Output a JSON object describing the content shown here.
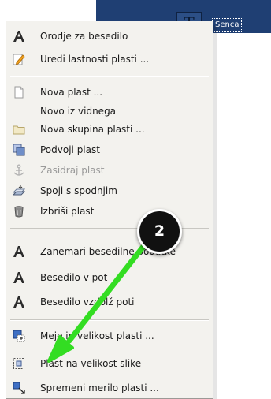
{
  "background": {
    "layer_name": "Senca",
    "thumb_glyph": "T",
    "strip_color": "#1f3f73"
  },
  "menu": {
    "items": [
      {
        "id": "text-tool",
        "label": "Orodje za besedilo",
        "icon": "text-tool-icon",
        "enabled": true
      },
      {
        "id": "edit-attributes",
        "label": "Uredi lastnosti plasti ...",
        "icon": "edit-attributes-icon",
        "enabled": true
      },
      {
        "id": "new-layer",
        "label": "Nova plast ...",
        "icon": "new-layer-icon",
        "enabled": true
      },
      {
        "id": "new-from-visible",
        "label": "Novo iz vidnega",
        "icon": "",
        "enabled": true
      },
      {
        "id": "new-layer-group",
        "label": "Nova skupina plasti ...",
        "icon": "folder-icon",
        "enabled": true
      },
      {
        "id": "duplicate-layer",
        "label": "Podvoji plast",
        "icon": "duplicate-icon",
        "enabled": true
      },
      {
        "id": "anchor-layer",
        "label": "Zasidraj plast",
        "icon": "anchor-icon",
        "enabled": false
      },
      {
        "id": "merge-down",
        "label": "Spoji s spodnjim",
        "icon": "merge-down-icon",
        "enabled": true
      },
      {
        "id": "delete-layer",
        "label": "Izbriši plast",
        "icon": "trash-icon",
        "enabled": true
      },
      {
        "id": "discard-text-info",
        "label": "Zanemari besedilne podatke",
        "icon": "text-tool-icon",
        "enabled": true
      },
      {
        "id": "text-to-path",
        "label": "Besedilo v pot",
        "icon": "text-tool-icon",
        "enabled": true
      },
      {
        "id": "text-along-path",
        "label": "Besedilo vzdolž poti",
        "icon": "text-tool-icon",
        "enabled": true
      },
      {
        "id": "layer-boundary-size",
        "label": "Meje in velikost plasti ...",
        "icon": "boundary-size-icon",
        "enabled": true
      },
      {
        "id": "layer-to-image-size",
        "label": "Plast na velikost slike",
        "icon": "fit-image-icon",
        "enabled": true
      },
      {
        "id": "scale-layer",
        "label": "Spremeni merilo plasti ...",
        "icon": "scale-icon",
        "enabled": true
      }
    ]
  },
  "annotation": {
    "callout_number": "2",
    "arrow_color": "#33dd22"
  }
}
